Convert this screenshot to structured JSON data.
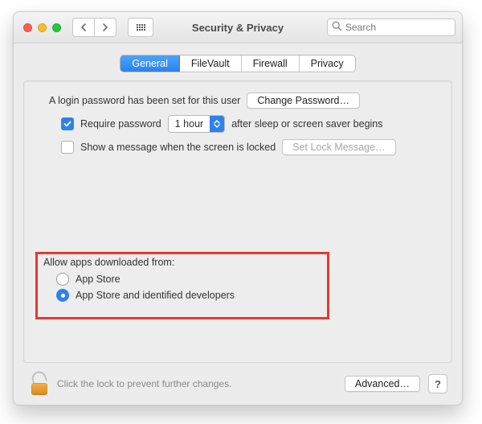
{
  "window": {
    "title": "Security & Privacy"
  },
  "search": {
    "placeholder": "Search"
  },
  "tabs": {
    "general": "General",
    "filevault": "FileVault",
    "firewall": "Firewall",
    "privacy": "Privacy"
  },
  "login": {
    "set_text": "A login password has been set for this user",
    "change_btn": "Change Password…",
    "require_label": "Require password",
    "require_select_value": "1 hour",
    "require_tail": "after sleep or screen saver begins",
    "show_msg_label": "Show a message when the screen is locked",
    "set_lock_btn": "Set Lock Message…"
  },
  "allow": {
    "heading": "Allow apps downloaded from:",
    "opt_appstore": "App Store",
    "opt_identified": "App Store and identified developers"
  },
  "footer": {
    "lock_text": "Click the lock to prevent further changes.",
    "advanced_btn": "Advanced…",
    "help": "?"
  }
}
